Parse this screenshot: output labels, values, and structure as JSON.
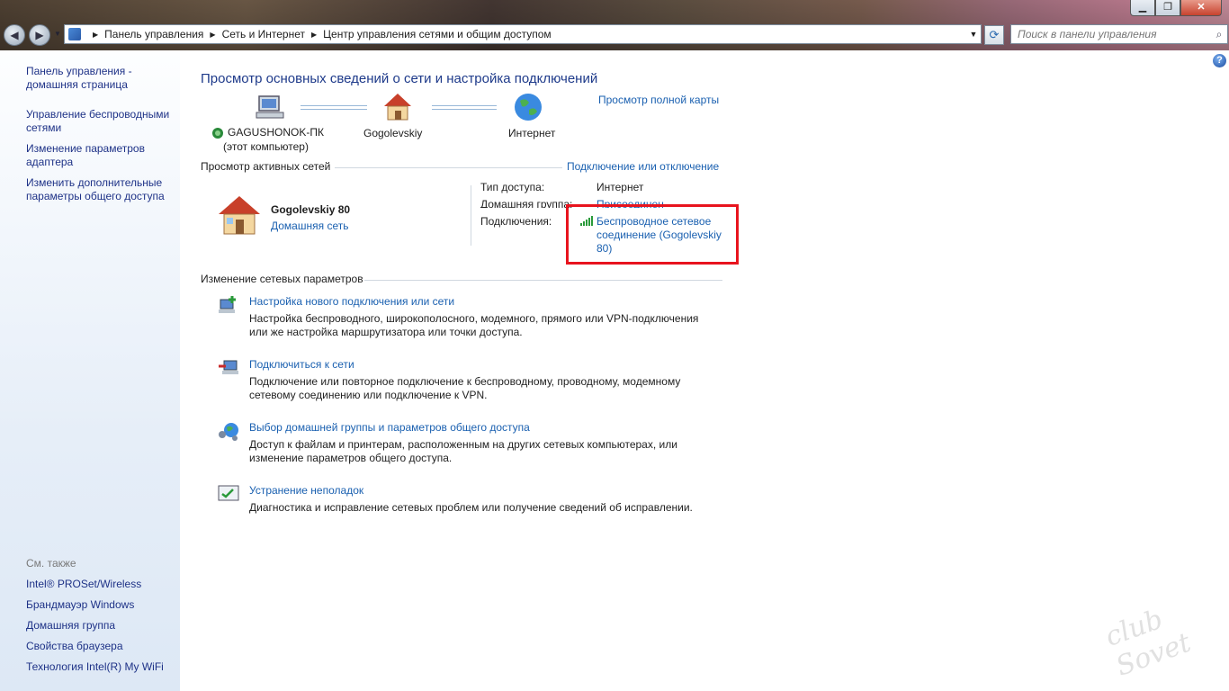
{
  "window": {
    "controls": {
      "minimize": "▁",
      "maximize": "❐",
      "close": "✕"
    }
  },
  "nav": {
    "back": "◀",
    "forward": "▶"
  },
  "address": {
    "crumbs": [
      "Панель управления",
      "Сеть и Интернет",
      "Центр управления сетями и общим доступом"
    ]
  },
  "search": {
    "placeholder": "Поиск в панели управления"
  },
  "sidebar": {
    "items": [
      {
        "label_l1": "Панель управления -",
        "label_l2": "домашняя страница"
      },
      {
        "label_l1": "Управление беспроводными",
        "label_l2": "сетями"
      },
      {
        "label_l1": "Изменение параметров",
        "label_l2": "адаптера"
      },
      {
        "label_l1": "Изменить дополнительные",
        "label_l2": "параметры общего доступа"
      }
    ],
    "see_also": "См. также",
    "see_also_items": [
      "Intel® PROSet/Wireless",
      "Брандмауэр Windows",
      "Домашняя группа",
      "Свойства браузера",
      "Технология Intel(R) My WiFi"
    ]
  },
  "main": {
    "title": "Просмотр основных сведений о сети и настройка подключений",
    "map_link": "Просмотр полной карты",
    "map": {
      "computer_name": "GAGUSHONOK-ПК",
      "computer_sub": "(этот компьютер)",
      "network": "Gogolevskiy",
      "internet": "Интернет"
    },
    "active": {
      "header": "Просмотр активных сетей",
      "connect_link": "Подключение или отключение",
      "network_name": "Gogolevskiy 80",
      "network_type": "Домашняя сеть",
      "access_label": "Тип доступа:",
      "access_value": "Интернет",
      "homegroup_label": "Домашняя группа:",
      "homegroup_value": "Присоединен",
      "connections_label": "Подключения:",
      "connection_l1": "Беспроводное сетевое",
      "connection_l2": "соединение (Gogolevskiy",
      "connection_l3": "80)"
    },
    "change": {
      "header": "Изменение сетевых параметров",
      "tasks": [
        {
          "title": "Настройка нового подключения или сети",
          "d1": "Настройка беспроводного, широкополосного, модемного, прямого или VPN-подключения",
          "d2": "или же настройка маршрутизатора или точки доступа."
        },
        {
          "title": "Подключиться к сети",
          "d1": "Подключение или повторное подключение к беспроводному, проводному, модемному",
          "d2": "сетевому соединению или подключение к VPN."
        },
        {
          "title": "Выбор домашней группы и параметров общего доступа",
          "d1": "Доступ к файлам и принтерам, расположенным на других сетевых компьютерах, или",
          "d2": "изменение параметров общего доступа."
        },
        {
          "title": "Устранение неполадок",
          "d1": "Диагностика и исправление сетевых проблем или получение сведений об исправлении.",
          "d2": ""
        }
      ]
    }
  },
  "watermark": "club Sovet",
  "colors": {
    "accent": "#1a60b0",
    "highlight": "#e8141e"
  }
}
